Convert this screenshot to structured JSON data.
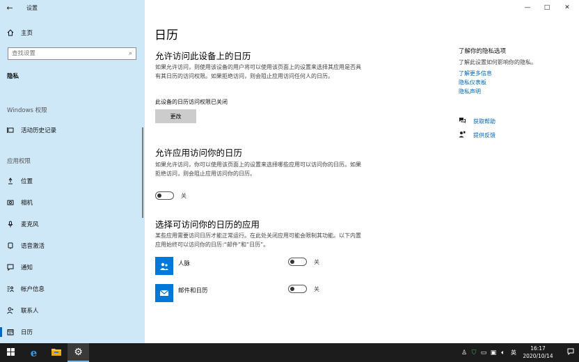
{
  "window": {
    "app_title": "设置",
    "controls": {
      "minimize": "—",
      "maximize": "□",
      "close": "✕"
    }
  },
  "sidebar": {
    "home_label": "主页",
    "search_placeholder": "查找设置",
    "privacy_heading": "隐私",
    "windows_permissions_label": "Windows 权限",
    "windows_items": [
      {
        "label": "活动历史记录",
        "icon": "activity-history-icon"
      }
    ],
    "app_permissions_label": "应用权限",
    "app_items": [
      {
        "label": "位置",
        "icon": "location-icon"
      },
      {
        "label": "相机",
        "icon": "camera-icon"
      },
      {
        "label": "麦克风",
        "icon": "microphone-icon"
      },
      {
        "label": "语音激活",
        "icon": "voice-activation-icon"
      },
      {
        "label": "通知",
        "icon": "notification-icon"
      },
      {
        "label": "帐户信息",
        "icon": "account-info-icon"
      },
      {
        "label": "联系人",
        "icon": "contacts-icon"
      },
      {
        "label": "日历",
        "icon": "calendar-icon",
        "active": true
      }
    ]
  },
  "main": {
    "title": "日历",
    "section1": {
      "heading": "允许访问此设备上的日历",
      "description": "如果允许访问，则使用该设备的用户将可以使用该页面上的设置来选择其应用是否具有其日历的访问权限。如果拒绝访问，则会阻止应用访问任何人的日历。",
      "status": "此设备的日历访问权限已关闭",
      "change_button": "更改"
    },
    "section2": {
      "heading": "允许应用访问你的日历",
      "description": "如果允许访问，你可以使用该页面上的设置来选择哪些应用可以访问你的日历。如果拒绝访问，则会阻止应用访问你的日历。",
      "toggle_state": "关"
    },
    "section3": {
      "heading": "选择可访问你的日历的应用",
      "description": "某些应用需要访问日历才能正常运行。在此处关闭应用可能会限制其功能。以下内置应用始终可以访问你的日历:“邮件”和“日历”。",
      "apps": [
        {
          "name": "人脉",
          "toggle_state": "关",
          "icon": "people-app-icon"
        },
        {
          "name": "邮件和日历",
          "toggle_state": "关",
          "icon": "mail-calendar-app-icon"
        }
      ]
    }
  },
  "right_pane": {
    "title": "了解你的隐私选项",
    "description": "了解此设置如何影响你的隐私。",
    "links": [
      "了解更多信息",
      "隐私仪表板",
      "隐私声明"
    ],
    "get_help": "获取帮助",
    "give_feedback": "提供反馈"
  },
  "taskbar": {
    "clock_time": "16:17",
    "clock_date": "2020/10/14",
    "ime_label": "英",
    "colors": {
      "background": "#1c1c1c",
      "accent": "#0078d7"
    }
  }
}
